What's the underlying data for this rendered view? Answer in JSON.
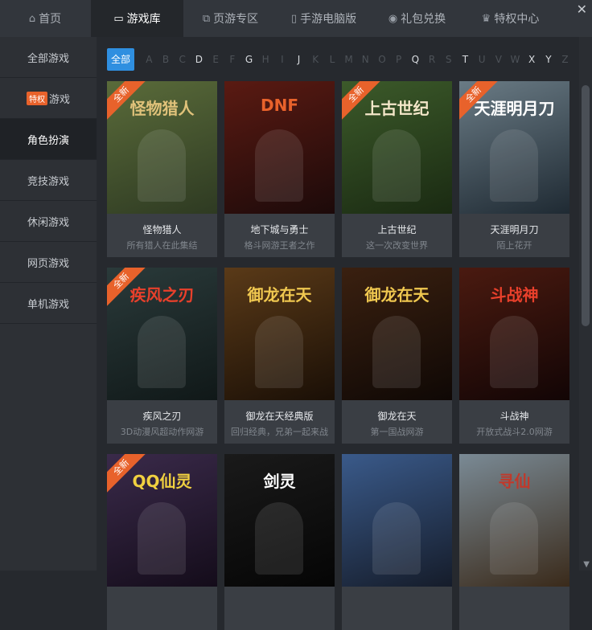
{
  "tabs": [
    {
      "label": "首页",
      "icon": "home-icon"
    },
    {
      "label": "游戏库",
      "icon": "monitor-icon"
    },
    {
      "label": "页游专区",
      "icon": "windows-icon"
    },
    {
      "label": "手游电脑版",
      "icon": "phone-icon"
    },
    {
      "label": "礼包兑换",
      "icon": "gift-icon"
    },
    {
      "label": "特权中心",
      "icon": "crown-icon"
    }
  ],
  "close_label": "✕",
  "sidebar": {
    "items": [
      {
        "label": "全部游戏"
      },
      {
        "label": "游戏",
        "tag": "特权"
      },
      {
        "label": "角色扮演"
      },
      {
        "label": "竞技游戏"
      },
      {
        "label": "休闲游戏"
      },
      {
        "label": "网页游戏"
      },
      {
        "label": "单机游戏"
      }
    ]
  },
  "filter": {
    "all_label": "全部",
    "letters": [
      "A",
      "B",
      "C",
      "D",
      "E",
      "F",
      "G",
      "H",
      "I",
      "J",
      "K",
      "L",
      "M",
      "N",
      "O",
      "P",
      "Q",
      "R",
      "S",
      "T",
      "U",
      "V",
      "W",
      "X",
      "Y",
      "Z"
    ],
    "active_letters": [
      "D",
      "G",
      "J",
      "Q",
      "T",
      "X",
      "Y"
    ]
  },
  "games": [
    {
      "title": "怪物猎人",
      "subtitle": "所有猎人在此集结",
      "ribbon": "全新",
      "art_text": "怪物猎人",
      "bg": [
        "#5a6b3a",
        "#2e3a22"
      ],
      "accent": "#e0c27a"
    },
    {
      "title": "地下城与勇士",
      "subtitle": "格斗网游王者之作",
      "ribbon": "",
      "art_text": "DNF",
      "bg": [
        "#5a1a12",
        "#1c0a0a"
      ],
      "accent": "#e8622b"
    },
    {
      "title": "上古世纪",
      "subtitle": "这一次改变世界",
      "ribbon": "全新",
      "art_text": "上古世纪",
      "bg": [
        "#3c5a2a",
        "#1a2a12"
      ],
      "accent": "#f4e7c9"
    },
    {
      "title": "天涯明月刀",
      "subtitle": "陌上花开",
      "ribbon": "全新",
      "art_text": "天涯明月刀",
      "bg": [
        "#6a7b85",
        "#1f2a33"
      ],
      "accent": "#ffffff"
    },
    {
      "title": "疾风之刃",
      "subtitle": "3D动漫风超动作网游",
      "ribbon": "全新",
      "art_text": "疾风之刃",
      "bg": [
        "#2a3a3a",
        "#101818"
      ],
      "accent": "#e8402b"
    },
    {
      "title": "御龙在天经典版",
      "subtitle": "回归经典，兄弟一起来战",
      "ribbon": "",
      "art_text": "御龙在天",
      "bg": [
        "#5a3a18",
        "#1a0f06"
      ],
      "accent": "#f0c850"
    },
    {
      "title": "御龙在天",
      "subtitle": "第一国战网游",
      "ribbon": "",
      "art_text": "御龙在天",
      "bg": [
        "#3a2010",
        "#0f0805"
      ],
      "accent": "#f0c850"
    },
    {
      "title": "斗战神",
      "subtitle": "开放式战斗2.0网游",
      "ribbon": "",
      "art_text": "斗战神",
      "bg": [
        "#4a1a10",
        "#120505"
      ],
      "accent": "#e8402b"
    },
    {
      "title": "",
      "subtitle": "",
      "ribbon": "全新",
      "art_text": "QQ仙灵",
      "bg": [
        "#3a2a4a",
        "#140c1a"
      ],
      "accent": "#f0d040"
    },
    {
      "title": "",
      "subtitle": "",
      "ribbon": "",
      "art_text": "剑灵",
      "bg": [
        "#1a1a1a",
        "#050505"
      ],
      "accent": "#ffffff"
    },
    {
      "title": "",
      "subtitle": "",
      "ribbon": "",
      "art_text": "",
      "bg": [
        "#3a5a8a",
        "#151c2a"
      ],
      "accent": "#ffffff"
    },
    {
      "title": "",
      "subtitle": "",
      "ribbon": "",
      "art_text": "寻仙",
      "bg": [
        "#7a8a95",
        "#3a2a1a"
      ],
      "accent": "#c0392b"
    }
  ]
}
